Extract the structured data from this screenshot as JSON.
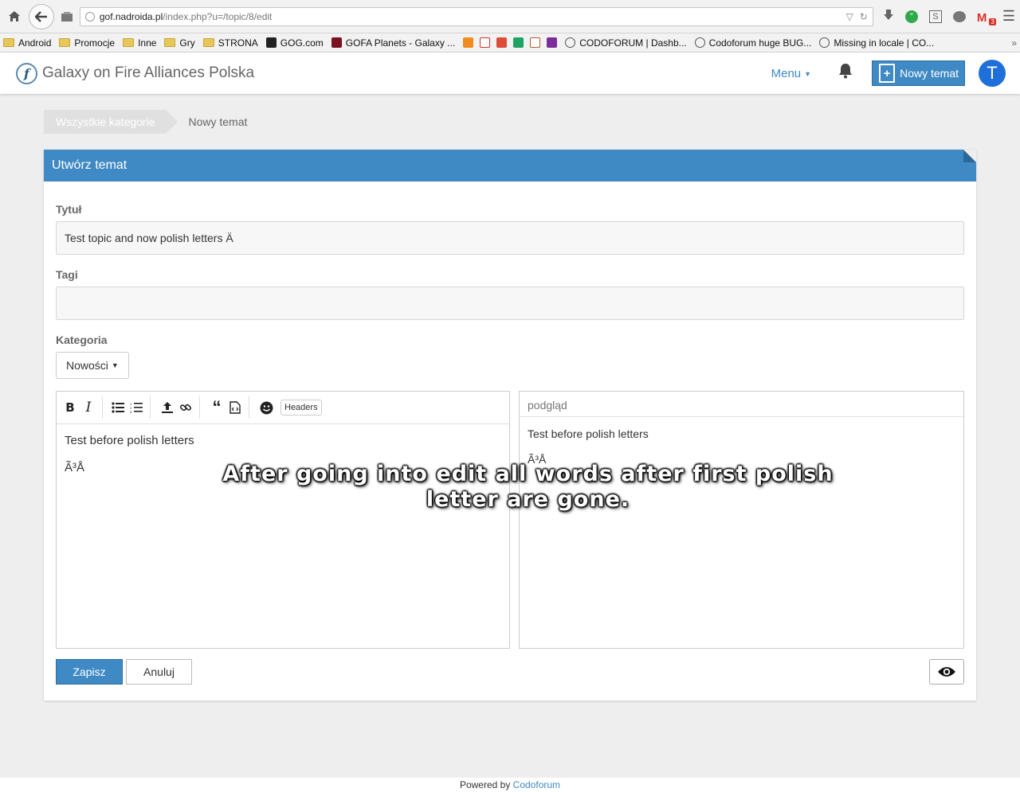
{
  "browser": {
    "url_host": "gof.nadroida.pl",
    "url_path": "/index.php?u=/topic/8/edit",
    "bookmarks": [
      {
        "label": "Android",
        "icon": "folder-icon"
      },
      {
        "label": "Promocje",
        "icon": "folder-icon"
      },
      {
        "label": "Inne",
        "icon": "folder-icon"
      },
      {
        "label": "Gry",
        "icon": "folder-icon"
      },
      {
        "label": "STRONA",
        "icon": "folder-icon"
      },
      {
        "label": "GOG.com",
        "icon": "gog-icon"
      },
      {
        "label": "GOFA Planets - Galaxy ...",
        "icon": "gofa-icon"
      },
      {
        "label": "CODOFORUM | Dashb...",
        "icon": "codoforum-icon"
      },
      {
        "label": "Codoforum huge BUG...",
        "icon": "codoforum-icon"
      },
      {
        "label": "Missing in locale | CO...",
        "icon": "codoforum-icon"
      }
    ],
    "gmail_badge": "3"
  },
  "header": {
    "site_title": "Galaxy on Fire Alliances Polska",
    "logo_letter": "f",
    "menu_label": "Menu",
    "new_topic_label": "Nowy temat",
    "avatar_letter": "T"
  },
  "breadcrumb": {
    "all_categories": "Wszystkie kategorie",
    "current": "Nowy temat"
  },
  "form": {
    "heading": "Utwórz temat",
    "title_label": "Tytuł",
    "title_value": "Test topic and now polish letters Ä",
    "tags_label": "Tagi",
    "tags_value": "",
    "category_label": "Kategoria",
    "category_value": "Nowości",
    "toolbar": {
      "headers_label": "Headers"
    },
    "editor_lines": [
      "Test before polish letters",
      "Ã³Å"
    ],
    "preview_title": "podgląd",
    "preview_lines": [
      "Test before polish letters",
      "Ã³Å"
    ],
    "save_label": "Zapisz",
    "cancel_label": "Anuluj"
  },
  "overlay": {
    "caption": "After going into edit all words after first polish letter are gone."
  },
  "footer": {
    "powered_by": "Powered by",
    "brand": "Codoforum"
  },
  "colors": {
    "accent": "#3f89c4",
    "avatar": "#1e6fd9"
  }
}
